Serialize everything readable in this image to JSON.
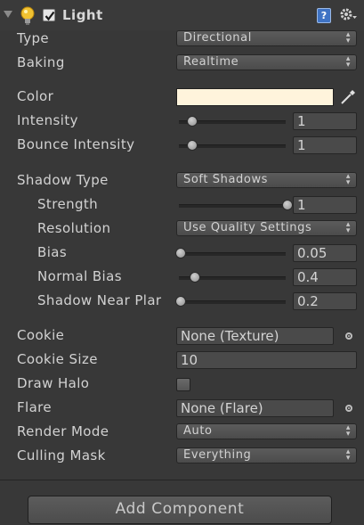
{
  "component": {
    "title": "Light",
    "enabled": true,
    "icons": {
      "fold": "foldout-arrow-icon",
      "light": "lightbulb-icon",
      "help": "help-book-icon",
      "settings": "gear-icon"
    }
  },
  "properties": {
    "type": {
      "label": "Type",
      "value": "Directional"
    },
    "baking": {
      "label": "Baking",
      "value": "Realtime"
    },
    "color": {
      "label": "Color",
      "value": "#fff4dc"
    },
    "intensity": {
      "label": "Intensity",
      "value": "1",
      "slider_fraction": 0.11
    },
    "bounce_intensity": {
      "label": "Bounce Intensity",
      "value": "1",
      "slider_fraction": 0.11
    },
    "shadow_type": {
      "label": "Shadow Type",
      "value": "Soft Shadows"
    },
    "strength": {
      "label": "Strength",
      "value": "1",
      "slider_fraction": 1.0
    },
    "resolution": {
      "label": "Resolution",
      "value": "Use Quality Settings"
    },
    "bias": {
      "label": "Bias",
      "value": "0.05",
      "slider_fraction": 0.0
    },
    "normal_bias": {
      "label": "Normal Bias",
      "value": "0.4",
      "slider_fraction": 0.13
    },
    "shadow_near_plane": {
      "label": "Shadow Near Plar",
      "value": "0.2",
      "slider_fraction": 0.0
    },
    "cookie": {
      "label": "Cookie",
      "value": "None (Texture)"
    },
    "cookie_size": {
      "label": "Cookie Size",
      "value": "10"
    },
    "draw_halo": {
      "label": "Draw Halo",
      "checked": false
    },
    "flare": {
      "label": "Flare",
      "value": "None (Flare)"
    },
    "render_mode": {
      "label": "Render Mode",
      "value": "Auto"
    },
    "culling_mask": {
      "label": "Culling Mask",
      "value": "Everything"
    }
  },
  "footer": {
    "add_component_label": "Add Component"
  },
  "colors": {
    "background": "#383838",
    "help_icon": "#3f73c4"
  }
}
